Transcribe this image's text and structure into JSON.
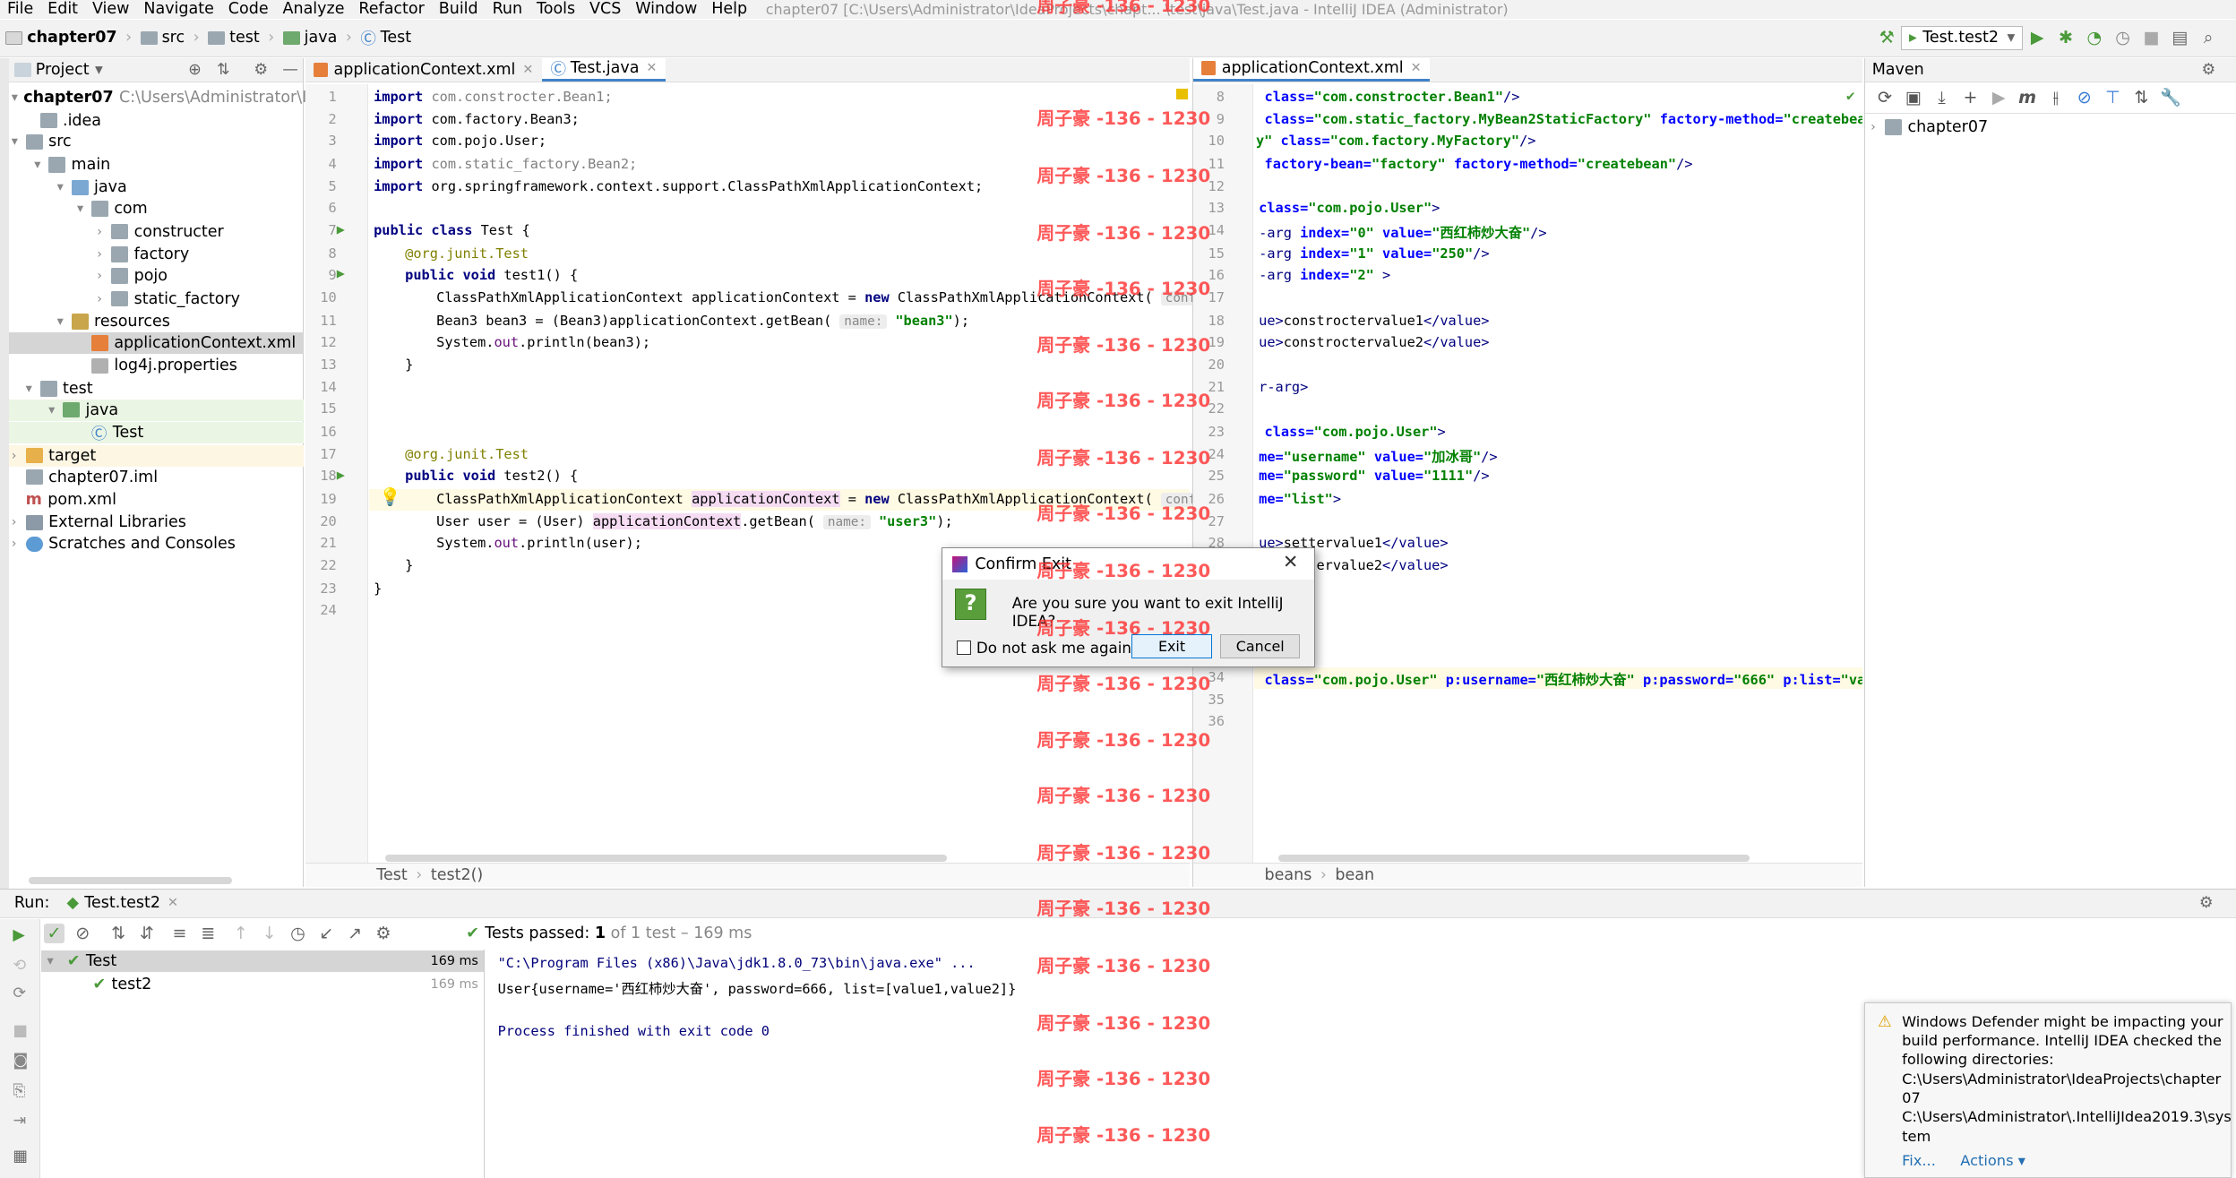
{
  "menu": {
    "items": [
      "File",
      "Edit",
      "View",
      "Navigate",
      "Code",
      "Analyze",
      "Refactor",
      "Build",
      "Run",
      "Tools",
      "VCS",
      "Window",
      "Help"
    ],
    "window_title": "chapter07 [C:\\Users\\Administrator\\IdeaProjects\\chapt... \\test\\java\\Test.java - IntelliJ IDEA (Administrator)"
  },
  "breadcrumb": [
    "chapter07",
    "src",
    "test",
    "java",
    "Test"
  ],
  "run_config": "Test.test2",
  "project_panel": {
    "title": "Project",
    "root_label": "chapter07",
    "root_path": "C:\\Users\\Administrator\\IdeaPro",
    "tree": [
      {
        "label": "chapter07"
      },
      {
        "label": ".idea"
      },
      {
        "label": "src"
      },
      {
        "label": "main"
      },
      {
        "label": "java"
      },
      {
        "label": "com"
      },
      {
        "label": "constructer"
      },
      {
        "label": "factory"
      },
      {
        "label": "pojo"
      },
      {
        "label": "static_factory"
      },
      {
        "label": "resources"
      },
      {
        "label": "applicationContext.xml"
      },
      {
        "label": "log4j.properties"
      },
      {
        "label": "test"
      },
      {
        "label": "java"
      },
      {
        "label": "Test"
      },
      {
        "label": "target"
      },
      {
        "label": "chapter07.iml"
      },
      {
        "label": "pom.xml"
      },
      {
        "label": "External Libraries"
      },
      {
        "label": "Scratches and Consoles"
      }
    ]
  },
  "editor_left": {
    "tabs": [
      "applicationContext.xml",
      "Test.java"
    ],
    "status": [
      "Test",
      "test2()"
    ],
    "line_numbers": [
      "1",
      "2",
      "3",
      "4",
      "5",
      "6",
      "7",
      "8",
      "9",
      "10",
      "11",
      "12",
      "13",
      "14",
      "15",
      "16",
      "17",
      "18",
      "19",
      "20",
      "21",
      "22",
      "23",
      "24"
    ]
  },
  "editor_right": {
    "tab": "applicationContext.xml",
    "status": [
      "beans",
      "bean"
    ],
    "line_numbers": [
      "8",
      "9",
      "10",
      "11",
      "12",
      "13",
      "14",
      "15",
      "16",
      "17",
      "18",
      "19",
      "20",
      "21",
      "22",
      "23",
      "24",
      "25",
      "26",
      "27",
      "28",
      "34",
      "35",
      "36"
    ]
  },
  "maven": {
    "title": "Maven",
    "root": "chapter07"
  },
  "run": {
    "label": "Run:",
    "tab": "Test.test2",
    "tests_passed": "Tests passed:",
    "tests_count": "1",
    "tests_detail": "of 1 test – 169 ms",
    "tree": [
      {
        "label": "Test",
        "time": "169 ms"
      },
      {
        "label": "test2",
        "time": "169 ms"
      }
    ],
    "console": [
      "\"C:\\Program Files (x86)\\Java\\jdk1.8.0_73\\bin\\java.exe\" ...",
      "User{username='西红柿炒大奋', password=666, list=[value1,value2]}",
      "",
      "Process finished with exit code 0"
    ]
  },
  "dialog": {
    "title": "Confirm Exit",
    "message": "Are you sure you want to exit IntelliJ IDEA?",
    "checkbox": "Do not ask me again",
    "exit": "Exit",
    "cancel": "Cancel"
  },
  "notification": {
    "text_lines": [
      "Windows Defender might be impacting your",
      "build performance. IntelliJ IDEA checked the",
      "following directories:",
      "C:\\Users\\Administrator\\IdeaProjects\\chapter",
      "07",
      "C:\\Users\\Administrator\\.IntelliJIdea2019.3\\sys",
      "tem"
    ],
    "fix": "Fix...",
    "actions": "Actions"
  },
  "watermark": "周子豪 -136 - 1230",
  "colors": {
    "accent": "#4083c9",
    "success": "#4a9a3a",
    "watermark": "#ff3030",
    "keyword": "#000080",
    "string": "#008000"
  }
}
